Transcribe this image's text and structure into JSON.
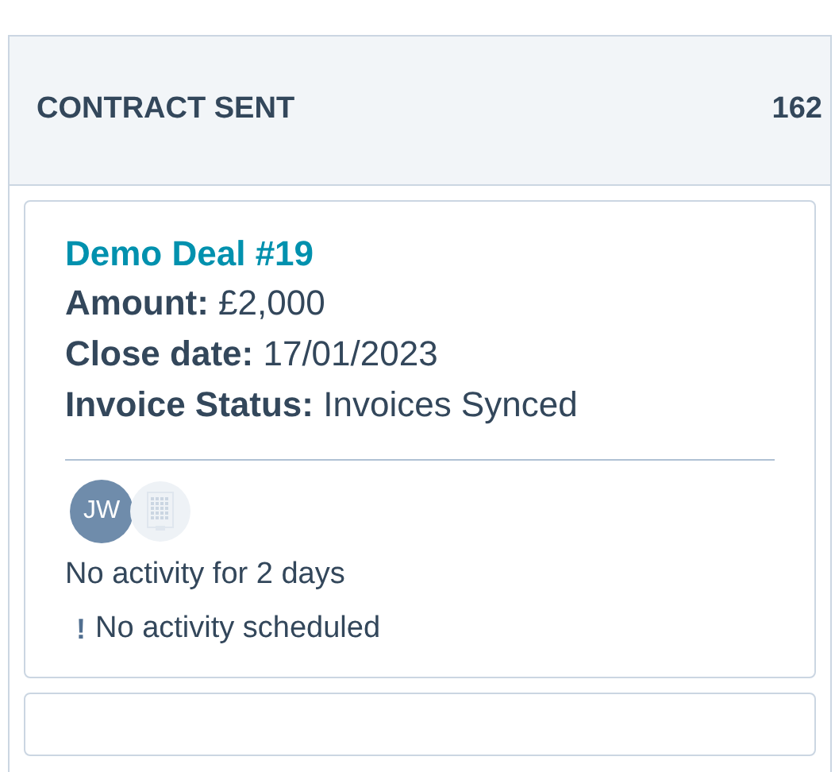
{
  "column": {
    "title": "CONTRACT SENT",
    "count": "162"
  },
  "cards": [
    {
      "title": "Demo Deal #19",
      "fields": [
        {
          "label": "Amount:",
          "value": "£2,000"
        },
        {
          "label": "Close date:",
          "value": "17/01/2023"
        },
        {
          "label": "Invoice Status:",
          "value": "Invoices Synced"
        }
      ],
      "owners": [
        {
          "kind": "initials",
          "text": "JW"
        },
        {
          "kind": "company"
        }
      ],
      "activity": "No activity for 2 days",
      "warning": {
        "icon": "!",
        "text": "No activity scheduled"
      }
    }
  ]
}
